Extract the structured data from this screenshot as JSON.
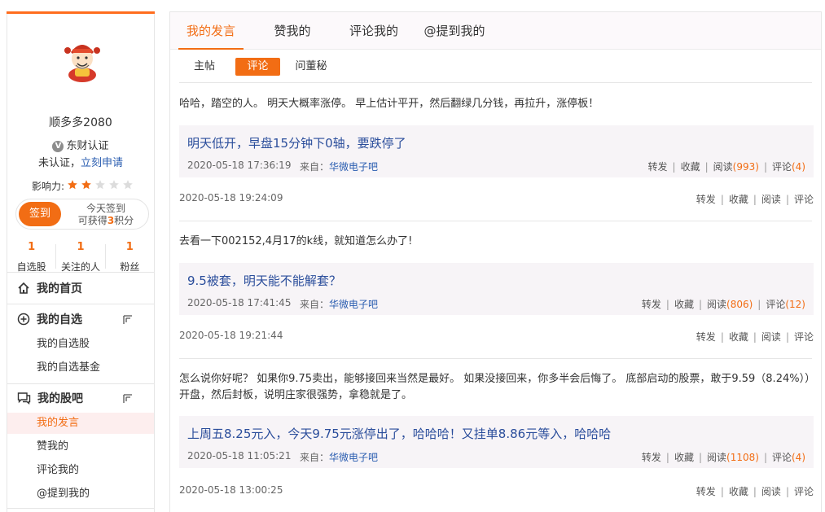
{
  "profile": {
    "username": "顺多多2080",
    "verify_badge": "V",
    "verify_label": "东财认证",
    "unverified": "未认证，",
    "apply": "立刻申请",
    "influence_label": "影响力:",
    "influence_stars": 2,
    "influence_max": 5,
    "sign_button": "签到",
    "sign_tip_line1": "今天签到",
    "sign_tip_pre": "可获得",
    "sign_tip_points": "3",
    "sign_tip_post": "积分"
  },
  "stats": [
    {
      "num": "1",
      "label": "自选股"
    },
    {
      "num": "1",
      "label": "关注的人"
    },
    {
      "num": "1",
      "label": "粉丝"
    }
  ],
  "nav": {
    "home": "我的首页",
    "watch": "我的自选",
    "watch_items": [
      "我的自选股",
      "我的自选基金"
    ],
    "bar": "我的股吧",
    "bar_items": [
      "我的发言",
      "赞我的",
      "评论我的",
      "@提到我的"
    ]
  },
  "tabs": [
    "我的发言",
    "赞我的",
    "评论我的",
    "@提到我的"
  ],
  "subtabs": [
    "主帖",
    "评论",
    "问董秘"
  ],
  "action_labels": {
    "forward": "转发",
    "collect": "收藏",
    "read": "阅读",
    "comment": "评论",
    "source_prefix": "来自："
  },
  "posts": [
    {
      "text": "哈哈，踏空的人。 明天大概率涨停。 早上估计平开，然后翻绿几分钱，再拉升，涨停板！",
      "quote_title": "明天低开，早盘15分钟下0轴，要跌停了",
      "quote_time": "2020-05-18 17:36:19",
      "quote_source": "华微电子吧",
      "quote_reads": "(993)",
      "quote_comments": "(4)",
      "time": "2020-05-18 19:24:09"
    },
    {
      "text": "去看一下002152,4月17的k线，就知道怎么办了!",
      "quote_title": "9.5被套，明天能不能解套？",
      "quote_time": "2020-05-18 17:41:45",
      "quote_source": "华微电子吧",
      "quote_reads": "(806)",
      "quote_comments": "(12)",
      "time": "2020-05-18 19:21:44"
    },
    {
      "text": "怎么说你好呢？ 如果你9.75卖出，能够接回来当然是最好。 如果没接回来，你多半会后悔了。 底部启动的股票，敢于9.59（8.24%））开盘，然后封板，说明庄家很强势，拿稳就是了。",
      "quote_title": "上周五8.25元入，今天9.75元涨停出了，哈哈哈！又挂单8.86元等入，哈哈哈",
      "quote_time": "2020-05-18 11:05:21",
      "quote_source": "华微电子吧",
      "quote_reads": "(1108)",
      "quote_comments": "(4)",
      "time": "2020-05-18 13:00:25"
    }
  ],
  "colors": {
    "accent": "#f26d14",
    "link": "#2a4d9b",
    "active_nav_bg": "#fdeeee"
  }
}
